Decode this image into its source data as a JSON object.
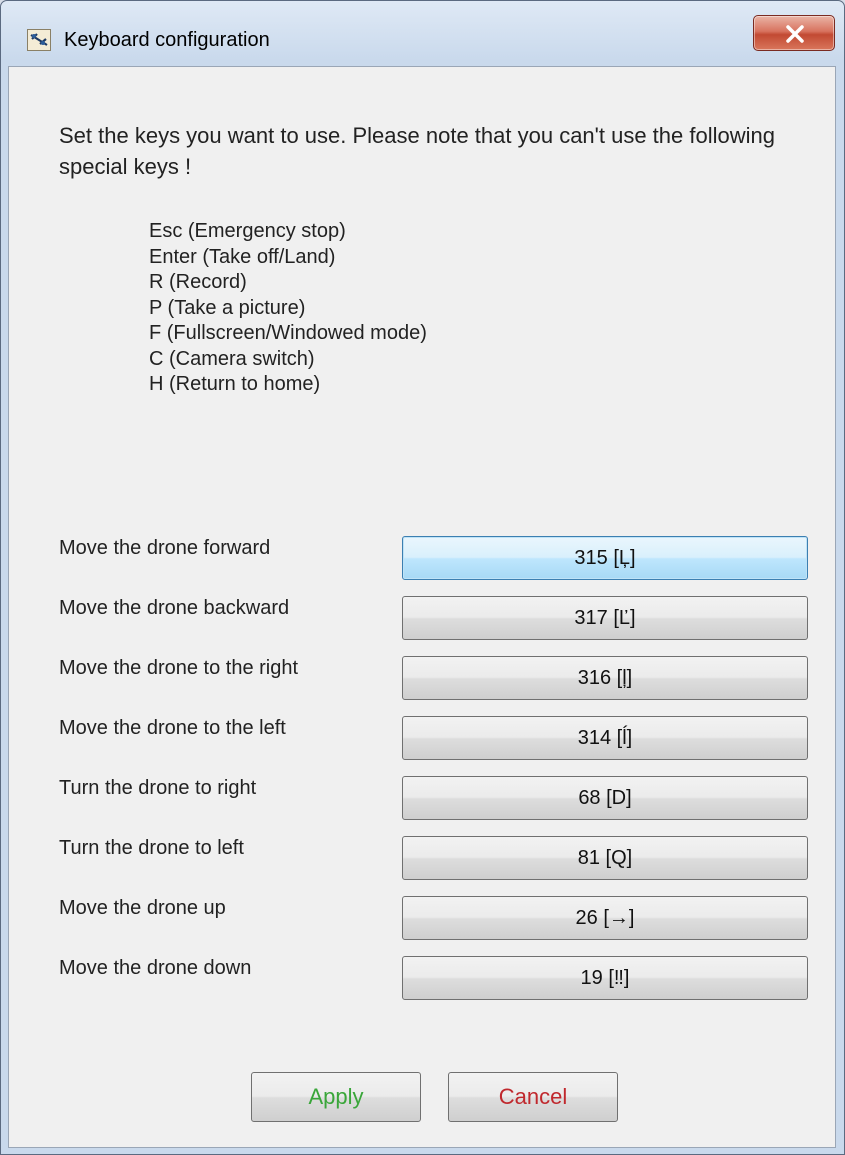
{
  "window": {
    "title": "Keyboard configuration",
    "close_icon": "close-x-icon",
    "app_icon": "drone-app-icon"
  },
  "intro_text": "Set the keys you want to use. Please note that you can't use the following special keys !",
  "special_keys": [
    "Esc (Emergency stop)",
    "Enter (Take off/Land)",
    "R (Record)",
    "P (Take a picture)",
    "F (Fullscreen/Windowed mode)",
    "C (Camera switch)",
    "H (Return to home)"
  ],
  "bindings": [
    {
      "label": "Move the drone forward",
      "key": "315 [Ļ]"
    },
    {
      "label": "Move the drone backward",
      "key": "317 [Ľ]"
    },
    {
      "label": "Move the drone to the right",
      "key": "316 [ļ]"
    },
    {
      "label": "Move the drone to the left",
      "key": "314 [ĺ]"
    },
    {
      "label": "Turn the drone to right",
      "key": "68 [D]"
    },
    {
      "label": "Turn the drone to left",
      "key": "81 [Q]"
    },
    {
      "label": "Move the drone up",
      "key": "26 [→]"
    },
    {
      "label": "Move the drone down",
      "key": "19 [‼]"
    }
  ],
  "buttons": {
    "apply_label": "Apply",
    "cancel_label": "Cancel"
  },
  "colors": {
    "apply_text": "#3aa63a",
    "cancel_text": "#c0282d",
    "focus_border": "#3c7fb1"
  }
}
